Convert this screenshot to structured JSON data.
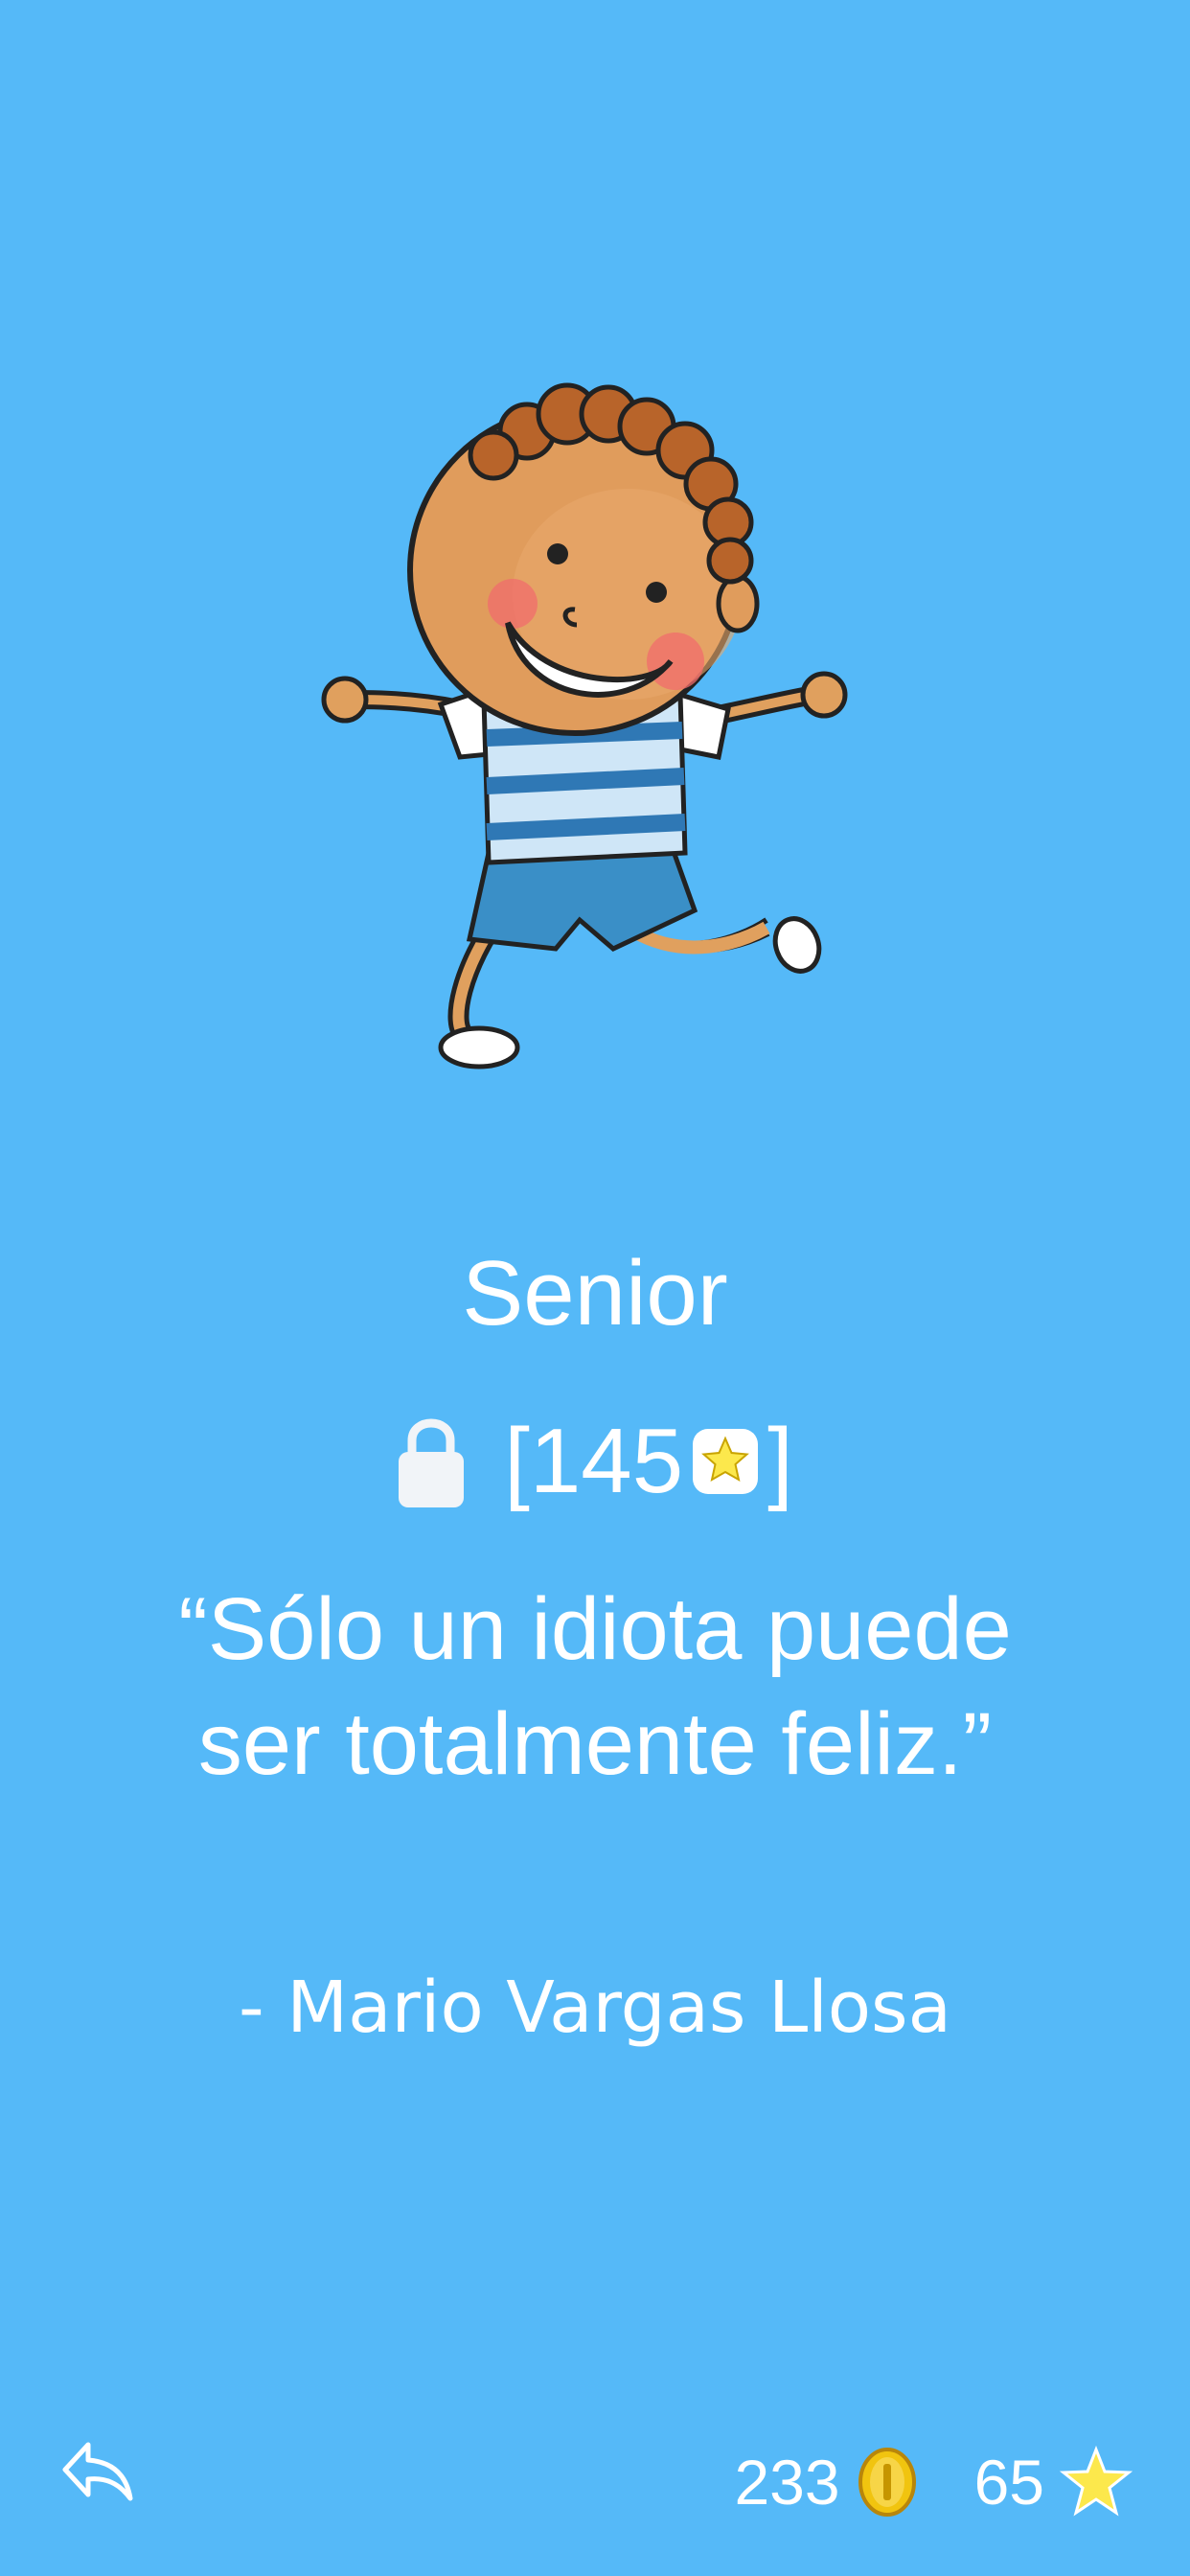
{
  "level": {
    "title": "Senior",
    "unlock_open_bracket": "[",
    "unlock_cost": "145",
    "unlock_close_bracket": "]",
    "locked": true
  },
  "quote": {
    "text": "“Sólo un idiota puede ser totalmente feliz.”",
    "author": "- Mario Vargas Llosa"
  },
  "footer": {
    "coins": "233",
    "stars": "65"
  },
  "icons": {
    "back": "back-arrow-icon",
    "lock": "lock-icon",
    "star": "star-icon",
    "coin": "coin-icon"
  },
  "colors": {
    "background": "#55b9f8",
    "text": "#ffffff",
    "star": "#fce84c",
    "coin": "#f1c40f"
  }
}
